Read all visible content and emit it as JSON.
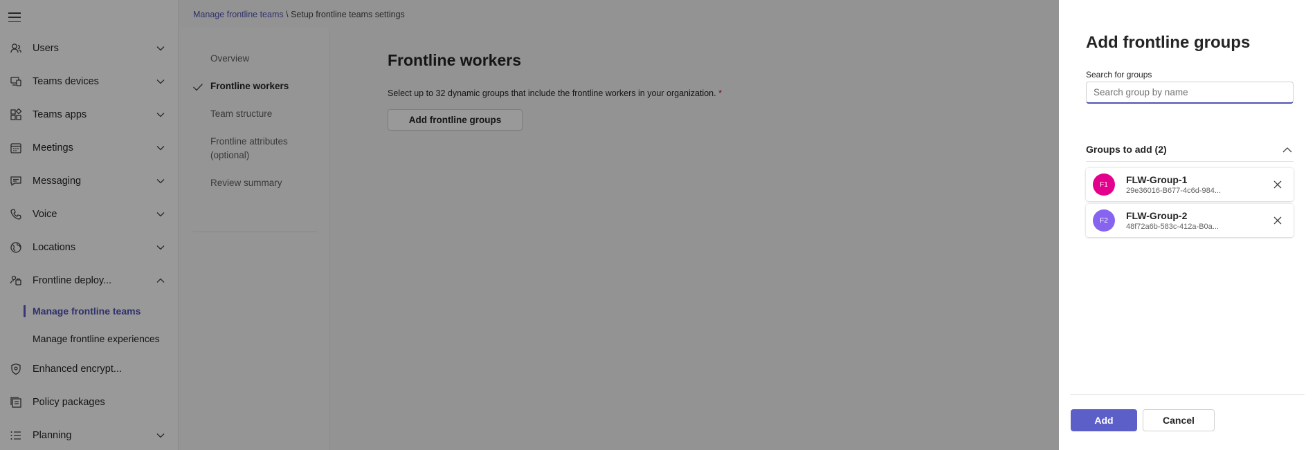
{
  "nav": {
    "items": [
      {
        "label": "Users",
        "icon": "users-icon",
        "expanded": false
      },
      {
        "label": "Teams devices",
        "icon": "devices-icon",
        "expanded": false
      },
      {
        "label": "Teams apps",
        "icon": "apps-icon",
        "expanded": false
      },
      {
        "label": "Meetings",
        "icon": "calendar-icon",
        "expanded": false
      },
      {
        "label": "Messaging",
        "icon": "chat-icon",
        "expanded": false
      },
      {
        "label": "Voice",
        "icon": "phone-icon",
        "expanded": false
      },
      {
        "label": "Locations",
        "icon": "globe-icon",
        "expanded": false
      },
      {
        "label": "Frontline deploy...",
        "icon": "frontline-icon",
        "expanded": true
      },
      {
        "label": "Enhanced encrypt...",
        "icon": "shield-icon"
      },
      {
        "label": "Policy packages",
        "icon": "package-icon"
      },
      {
        "label": "Planning",
        "icon": "list-icon",
        "expanded": false
      }
    ],
    "subitems": [
      {
        "label": "Manage frontline teams",
        "active": true
      },
      {
        "label": "Manage frontline experiences",
        "active": false
      }
    ]
  },
  "breadcrumb": {
    "link": "Manage frontline teams",
    "separator": "\\",
    "current": "Setup frontline teams settings"
  },
  "steps": [
    {
      "label": "Overview",
      "status": "completed"
    },
    {
      "label": "Frontline workers",
      "status": "current"
    },
    {
      "label": "Team structure",
      "status": "pending"
    },
    {
      "label": "Frontline attributes (optional)",
      "status": "pending"
    },
    {
      "label": "Review summary",
      "status": "pending"
    }
  ],
  "content": {
    "title": "Frontline workers",
    "description": "Select up to 32 dynamic groups that include the frontline workers in your organization.",
    "required_mark": "*",
    "button_label": "Add frontline groups"
  },
  "panel": {
    "title": "Add frontline groups",
    "search_label": "Search for groups",
    "search_placeholder": "Search group by name",
    "search_value": "",
    "groups_header": "Groups to add (2)",
    "groups": [
      {
        "initials": "F1",
        "name": "FLW-Group-1",
        "id": "29e36016-B677-4c6d-984...",
        "color": "#e3008c"
      },
      {
        "initials": "F2",
        "name": "FLW-Group-2",
        "id": "48f72a6b-583c-412a-B0a...",
        "color": "#8764f0"
      }
    ],
    "add_label": "Add",
    "cancel_label": "Cancel"
  },
  "colors": {
    "accent": "#5b5fc7",
    "link": "#4f52b2",
    "required": "#c50f1f"
  }
}
